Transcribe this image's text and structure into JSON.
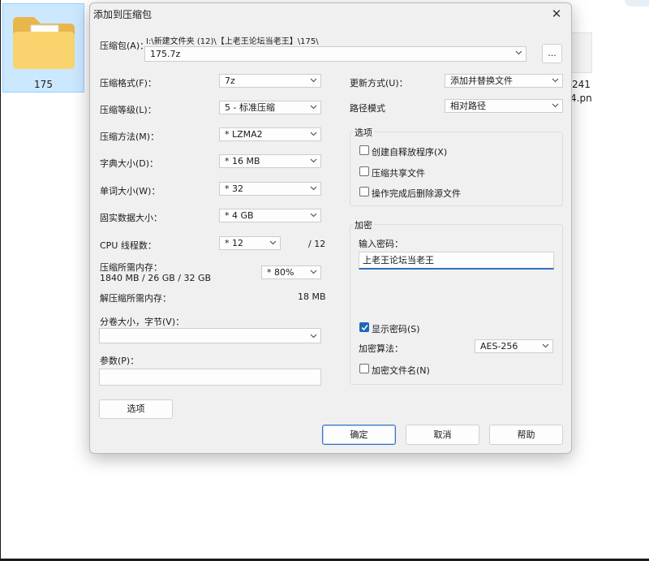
{
  "background": {
    "file_name": "175",
    "partial_file_text_1": "241",
    "partial_file_text_2": "4.pn"
  },
  "dialog": {
    "title": "添加到压缩包",
    "archive": {
      "label": "压缩包(A)：",
      "path": "I:\\新建文件夹 (12)\\【上老王论坛当老王】\\175\\",
      "name": "175.7z",
      "browse_label": "..."
    },
    "left": {
      "format": {
        "label": "压缩格式(F)：",
        "value": "7z"
      },
      "level": {
        "label": "压缩等级(L)：",
        "value": "5 - 标准压缩"
      },
      "method": {
        "label": "压缩方法(M)：",
        "value": "*  LZMA2"
      },
      "dict": {
        "label": "字典大小(D)：",
        "value": "*  16 MB"
      },
      "word": {
        "label": "单词大小(W)：",
        "value": "*  32"
      },
      "solid": {
        "label": "固实数据大小：",
        "value": "*  4 GB"
      },
      "threads": {
        "label": "CPU 线程数：",
        "value": "*  12",
        "max": "/ 12"
      },
      "memory": {
        "label": "压缩所需内存：",
        "detail": "1840 MB / 26 GB / 32 GB",
        "value": "*  80%"
      },
      "decompress_mem": {
        "label": "解压缩所需内存：",
        "value": "18 MB"
      },
      "split": {
        "label": "分卷大小，字节(V)：",
        "value": ""
      },
      "params": {
        "label": "参数(P)：",
        "value": ""
      },
      "options_button": "选项"
    },
    "right": {
      "update": {
        "label": "更新方式(U)：",
        "value": "添加并替换文件"
      },
      "path_mode": {
        "label": "路径模式",
        "value": "相对路径"
      },
      "options_group": {
        "title": "选项",
        "sfx": "创建自释放程序(X)",
        "shared": "压缩共享文件",
        "delete_after": "操作完成后删除源文件"
      },
      "encryption": {
        "title": "加密",
        "password_label": "输入密码：",
        "password_value": "上老王论坛当老王",
        "show_password": "显示密码(S)",
        "method_label": "加密算法：",
        "method_value": "AES-256",
        "encrypt_names": "加密文件名(N)"
      }
    },
    "buttons": {
      "ok": "确定",
      "cancel": "取消",
      "help": "帮助"
    }
  },
  "colors": {
    "accent": "#1f67b8",
    "selection": "#cce8ff",
    "dialog_bg": "#f0f0f0"
  },
  "icons": [
    "folder-icon",
    "close-icon",
    "chevron-down-icon",
    "checkmark-icon"
  ]
}
